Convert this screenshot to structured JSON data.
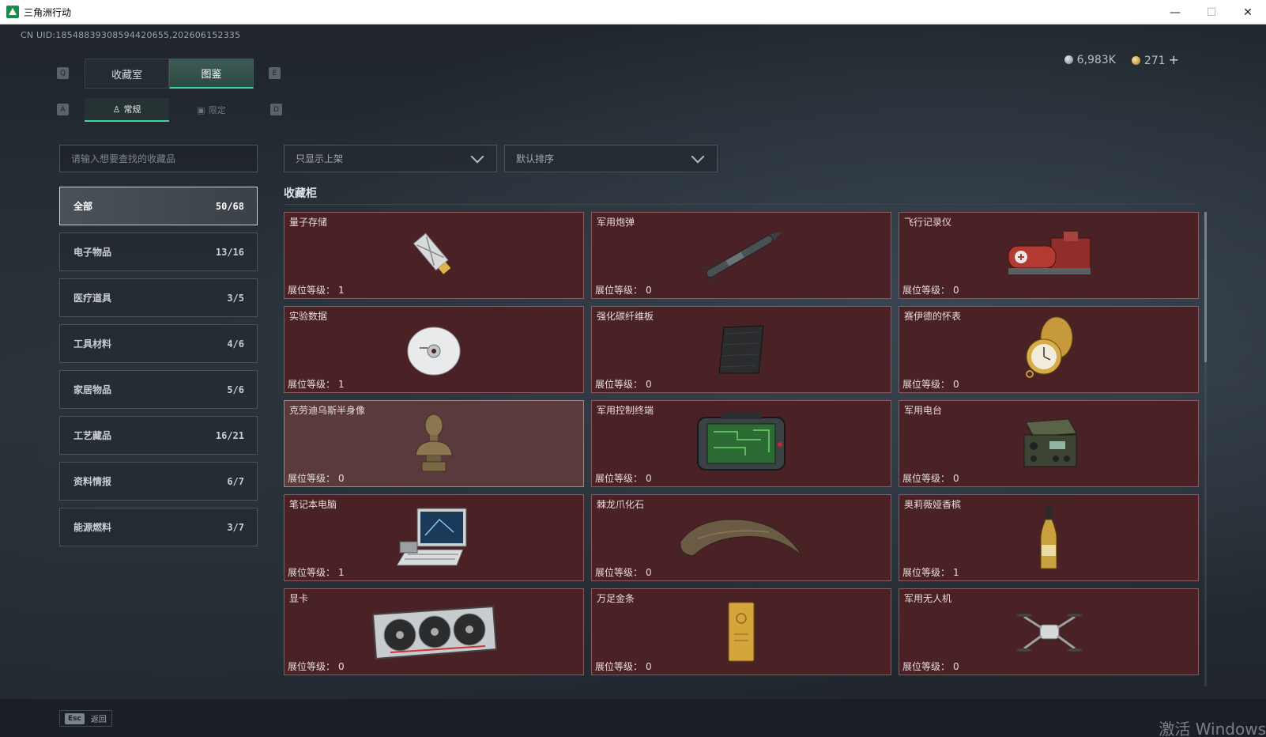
{
  "window": {
    "title": "三角洲行动",
    "min": "—",
    "max": "☐",
    "close": "✕"
  },
  "uid": "CN UID:18548839308594420655,202606152335",
  "currency": {
    "silver": "6,983K",
    "gold": "271",
    "plus": "+"
  },
  "hotkeys": {
    "q": "Q",
    "e": "E",
    "a": "A",
    "d": "D"
  },
  "main_tabs": [
    {
      "label": "收藏室"
    },
    {
      "label": "图鉴"
    }
  ],
  "sub_tabs": [
    {
      "label": "常规",
      "icon": "figure-icon"
    },
    {
      "label": "限定",
      "icon": "image-icon"
    }
  ],
  "search": {
    "placeholder": "请输入想要查找的收藏品"
  },
  "filters": {
    "shelf": "只显示上架",
    "sort": "默认排序"
  },
  "categories": [
    {
      "label": "全部",
      "count": "50/68"
    },
    {
      "label": "电子物品",
      "count": "13/16"
    },
    {
      "label": "医疗道具",
      "count": "3/5"
    },
    {
      "label": "工具材料",
      "count": "4/6"
    },
    {
      "label": "家居物品",
      "count": "5/6"
    },
    {
      "label": "工艺藏品",
      "count": "16/21"
    },
    {
      "label": "资料情报",
      "count": "6/7"
    },
    {
      "label": "能源燃料",
      "count": "3/7"
    }
  ],
  "section_title": "收藏柜",
  "level_label": "展位等级：",
  "items": [
    {
      "name": "量子存储",
      "level": "1",
      "icon": "usb-drive-icon"
    },
    {
      "name": "军用炮弹",
      "level": "0",
      "icon": "missile-icon"
    },
    {
      "name": "飞行记录仪",
      "level": "0",
      "icon": "flight-recorder-icon"
    },
    {
      "name": "实验数据",
      "level": "1",
      "icon": "disc-icon"
    },
    {
      "name": "强化碳纤维板",
      "level": "0",
      "icon": "carbon-plate-icon"
    },
    {
      "name": "赛伊德的怀表",
      "level": "0",
      "icon": "pocket-watch-icon"
    },
    {
      "name": "克劳迪乌斯半身像",
      "level": "0",
      "icon": "bust-icon"
    },
    {
      "name": "军用控制终端",
      "level": "0",
      "icon": "control-terminal-icon"
    },
    {
      "name": "军用电台",
      "level": "0",
      "icon": "radio-icon"
    },
    {
      "name": "笔记本电脑",
      "level": "1",
      "icon": "laptop-icon"
    },
    {
      "name": "棘龙爪化石",
      "level": "0",
      "icon": "claw-fossil-icon"
    },
    {
      "name": "奥莉薇娅香槟",
      "level": "1",
      "icon": "champagne-icon"
    },
    {
      "name": "显卡",
      "level": "0",
      "icon": "gpu-icon"
    },
    {
      "name": "万足金条",
      "level": "0",
      "icon": "gold-bar-icon"
    },
    {
      "name": "军用无人机",
      "level": "0",
      "icon": "drone-icon"
    }
  ],
  "bottom": {
    "esc_key": "Esc",
    "back_label": "返回"
  },
  "watermark": "激活 Windows"
}
